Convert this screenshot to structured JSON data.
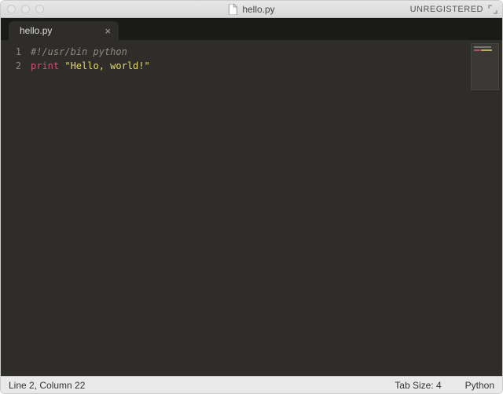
{
  "titlebar": {
    "filename": "hello.py",
    "registration": "UNREGISTERED"
  },
  "tabs": [
    {
      "label": "hello.py"
    }
  ],
  "editor": {
    "lines": [
      {
        "num": "1"
      },
      {
        "num": "2"
      }
    ],
    "line1_comment": "#!/usr/bin python",
    "line2_keyword": "print",
    "line2_space": " ",
    "line2_string": "\"Hello, world!\""
  },
  "statusbar": {
    "cursor": "Line 2, Column 22",
    "tabsize": "Tab Size: 4",
    "language": "Python"
  }
}
